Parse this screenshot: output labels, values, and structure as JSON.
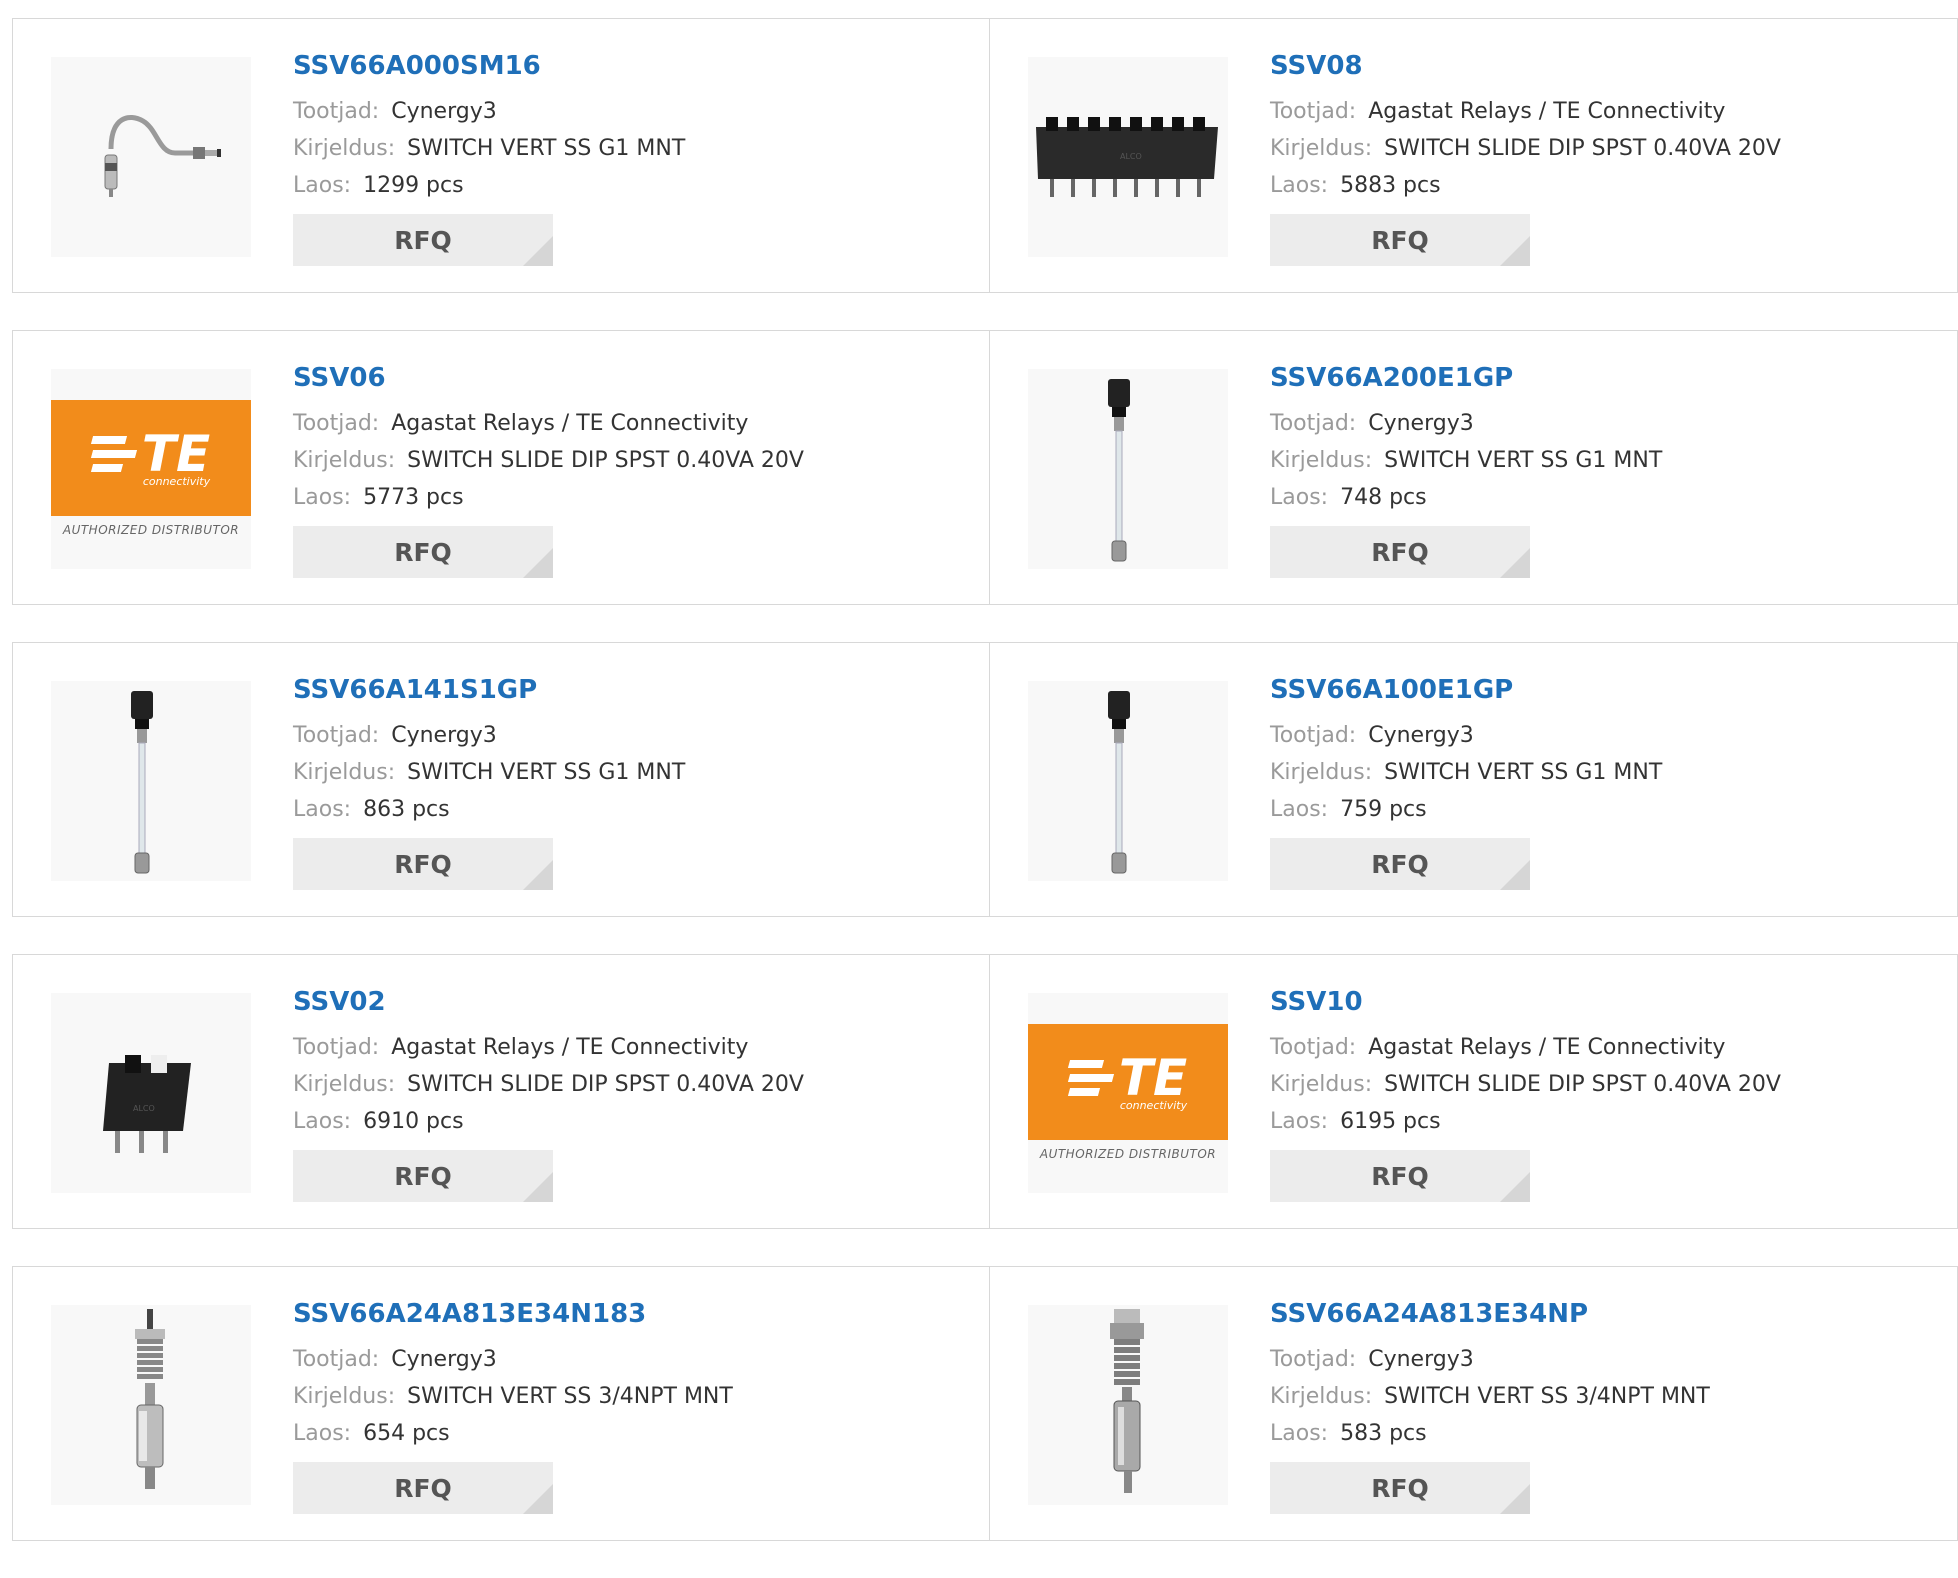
{
  "labels": {
    "manufacturer": "Tootjad:",
    "description": "Kirjeldus:",
    "stock": "Laos:",
    "rfq": "RFQ"
  },
  "te_logo": {
    "mark": "TE",
    "sub": "connectivity",
    "dist": "AUTHORIZED DISTRIBUTOR"
  },
  "products": [
    {
      "pn": "SSV66A000SM16",
      "manufacturer": "Cynergy3",
      "description": "SWITCH VERT SS G1 MNT",
      "stock": "1299 pcs",
      "image": "bent-float-switch"
    },
    {
      "pn": "SSV08",
      "manufacturer": "Agastat Relays / TE Connectivity",
      "description": "SWITCH SLIDE DIP SPST 0.40VA 20V",
      "stock": "5883 pcs",
      "image": "dip-switch-8"
    },
    {
      "pn": "SSV06",
      "manufacturer": "Agastat Relays / TE Connectivity",
      "description": "SWITCH SLIDE DIP SPST 0.40VA 20V",
      "stock": "5773 pcs",
      "image": "te-logo"
    },
    {
      "pn": "SSV66A200E1GP",
      "manufacturer": "Cynergy3",
      "description": "SWITCH VERT SS G1 MNT",
      "stock": "748 pcs",
      "image": "level-switch-tube"
    },
    {
      "pn": "SSV66A141S1GP",
      "manufacturer": "Cynergy3",
      "description": "SWITCH VERT SS G1 MNT",
      "stock": "863 pcs",
      "image": "level-switch-tube"
    },
    {
      "pn": "SSV66A100E1GP",
      "manufacturer": "Cynergy3",
      "description": "SWITCH VERT SS G1 MNT",
      "stock": "759 pcs",
      "image": "level-switch-tube"
    },
    {
      "pn": "SSV02",
      "manufacturer": "Agastat Relays / TE Connectivity",
      "description": "SWITCH SLIDE DIP SPST 0.40VA 20V",
      "stock": "6910 pcs",
      "image": "dip-switch-2"
    },
    {
      "pn": "SSV10",
      "manufacturer": "Agastat Relays / TE Connectivity",
      "description": "SWITCH SLIDE DIP SPST 0.40VA 20V",
      "stock": "6195 pcs",
      "image": "te-logo"
    },
    {
      "pn": "SSV66A24A813E34N183",
      "manufacturer": "Cynergy3",
      "description": "SWITCH VERT SS 3/4NPT MNT",
      "stock": "654 pcs",
      "image": "npt-float-switch"
    },
    {
      "pn": "SSV66A24A813E34NP",
      "manufacturer": "Cynergy3",
      "description": "SWITCH VERT SS 3/4NPT MNT",
      "stock": "583 pcs",
      "image": "npt-float-switch-2"
    }
  ]
}
